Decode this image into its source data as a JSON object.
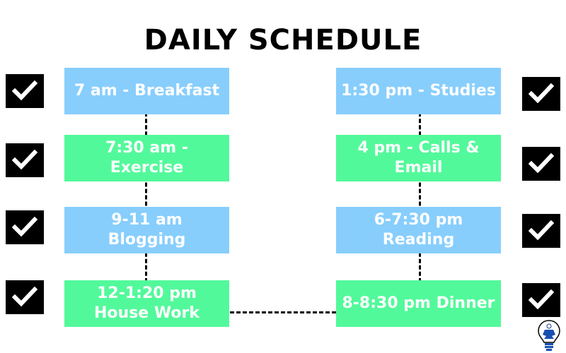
{
  "title": "DAILY SCHEDULE",
  "colors": {
    "blue": "#87cefd",
    "green": "#52f99a",
    "check_bg": "#000000",
    "text": "#ffffff"
  },
  "left_column": [
    {
      "label": "7 am - Breakfast",
      "color": "blue",
      "checked": true
    },
    {
      "label": "7:30 am - Exercise",
      "color": "green",
      "checked": true
    },
    {
      "label": "9-11 am Blogging",
      "color": "blue",
      "checked": true
    },
    {
      "label": "12-1:20 pm House Work",
      "color": "green",
      "checked": true
    }
  ],
  "right_column": [
    {
      "label": "1:30 pm - Studies",
      "color": "blue",
      "checked": true
    },
    {
      "label": "4 pm - Calls & Email",
      "color": "green",
      "checked": true
    },
    {
      "label": "6-7:30 pm Reading",
      "color": "blue",
      "checked": true
    },
    {
      "label": "8-8:30 pm Dinner",
      "color": "green",
      "checked": true
    }
  ],
  "logo_icon": "lightbulb-meditation-icon"
}
